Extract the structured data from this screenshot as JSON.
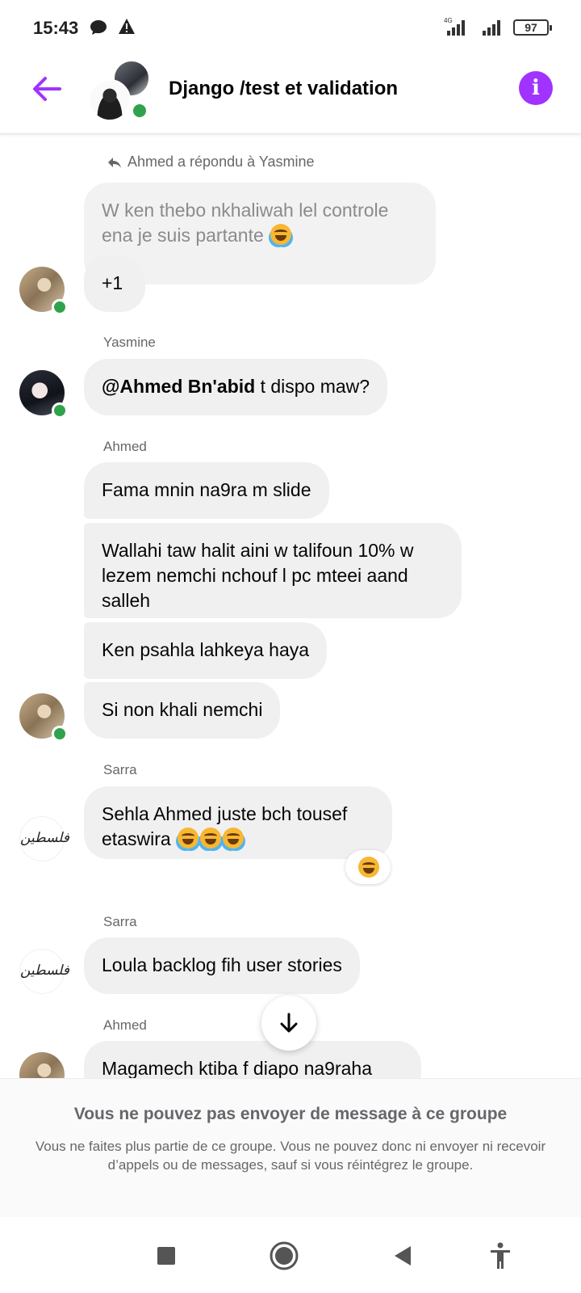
{
  "status_bar": {
    "time": "15:43",
    "network_label": "4G",
    "battery": "97",
    "icons": [
      "chat-bubble-icon",
      "warning-icon",
      "signal-icon",
      "signal-icon",
      "battery-icon"
    ]
  },
  "header": {
    "title": "Django /test et validation",
    "back_icon": "arrow-left-icon",
    "info_icon": "info-icon",
    "accent_color": "#a033ff",
    "online": true
  },
  "messages": {
    "reply_note": "Ahmed a répondu à Yasmine",
    "quoted_text": "W ken thebo nkhaliwah lel controle ena je suis partante",
    "plus_one": "+1",
    "yasmine_sender": "Yasmine",
    "yasmine_mention": "@Ahmed Bn'abid",
    "yasmine_text": " t dispo maw?",
    "ahmed_sender": "Ahmed",
    "ahmed_1": "Fama mnin na9ra m slide",
    "ahmed_2": "Wallahi taw halit aini w talifoun 10% w lezem nemchi nchouf l pc mteei aand salleh",
    "ahmed_3": "Ken psahla lahkeya haya",
    "ahmed_4": "Si non khali nemchi",
    "sarra_sender_1": "Sarra",
    "sarra_1": "Sehla Ahmed juste bch tousef etaswira",
    "sarra_sender_2": "Sarra",
    "sarra_2": "Loula backlog fih user stories",
    "ahmed_sender_2": "Ahmed",
    "ahmed_5": "Magamech ktiba f diapo na9raha",
    "sarra_avatar_text": "فلسطين"
  },
  "notice": {
    "title": "Vous ne pouvez pas envoyer de message à ce groupe",
    "body": "Vous ne faites plus partie de ce groupe. Vous ne pouvez donc ni envoyer ni recevoir d’appels ou de messages, sauf si vous réintégrez le groupe."
  },
  "nav_bar": {
    "icons": [
      "recents-square-icon",
      "home-circle-icon",
      "back-triangle-icon",
      "accessibility-icon"
    ]
  }
}
